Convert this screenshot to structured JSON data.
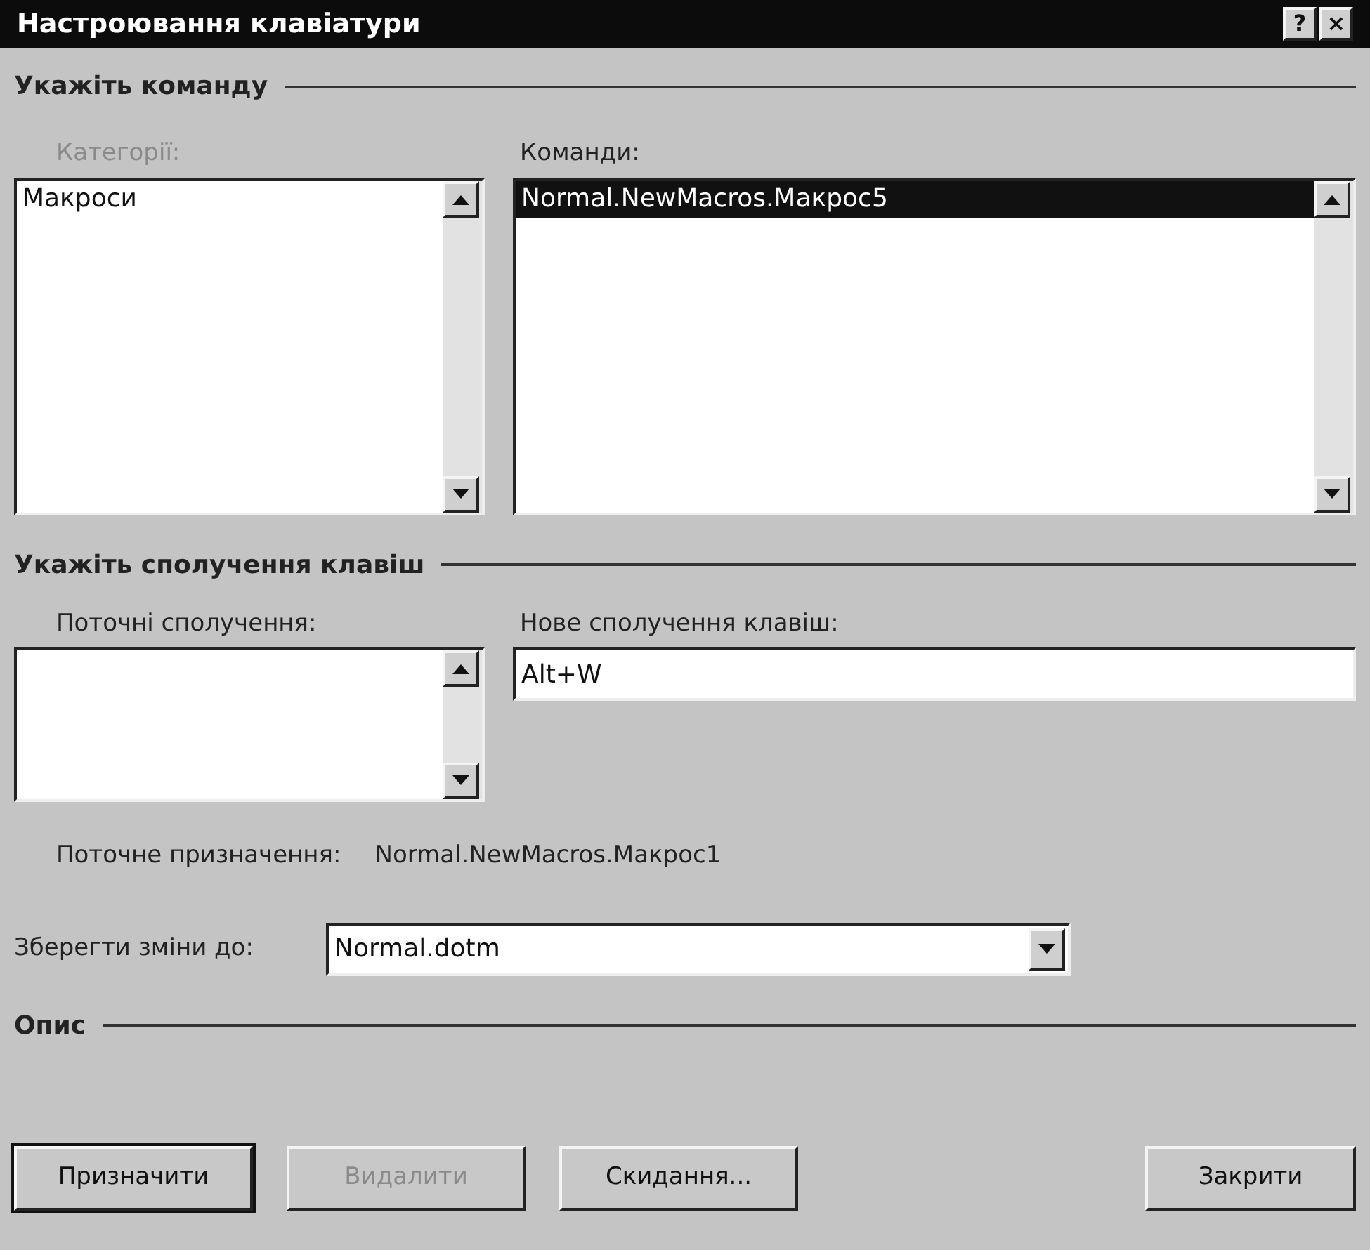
{
  "window": {
    "title": "Настроювання клавіатури",
    "buttons": [
      "?",
      "×"
    ]
  },
  "command_group": {
    "title": "Укажіть команду",
    "categories": {
      "label": "Категорії:",
      "disabled": true,
      "items": [
        {
          "label": "Макроси",
          "selected": false
        }
      ]
    },
    "commands": {
      "label": "Команди:",
      "disabled": false,
      "items": [
        {
          "label": "Normal.NewMacros.Макрос5",
          "selected": true
        }
      ]
    }
  },
  "keys_group": {
    "title": "Укажіть сполучення клавіш",
    "current_keys": {
      "label": "Поточні сполучення:"
    },
    "new_key": {
      "label": "Нове сполучення клавіш:",
      "value": "Alt+W"
    },
    "assignment": {
      "label": "Поточне призначення:",
      "value": "Normal.NewMacros.Макрос1"
    }
  },
  "save_to": {
    "label": "Зберегти зміни до:",
    "value": "Normal.dotm"
  },
  "description": {
    "title": "Опис"
  },
  "buttons": [
    {
      "label": "Призначити",
      "disabled": false,
      "default": true
    },
    {
      "label": "Видалити",
      "disabled": true,
      "default": false
    },
    {
      "label": "Скидання...",
      "disabled": false,
      "default": false
    },
    {
      "label": "Закрити",
      "disabled": false,
      "default": false
    }
  ]
}
